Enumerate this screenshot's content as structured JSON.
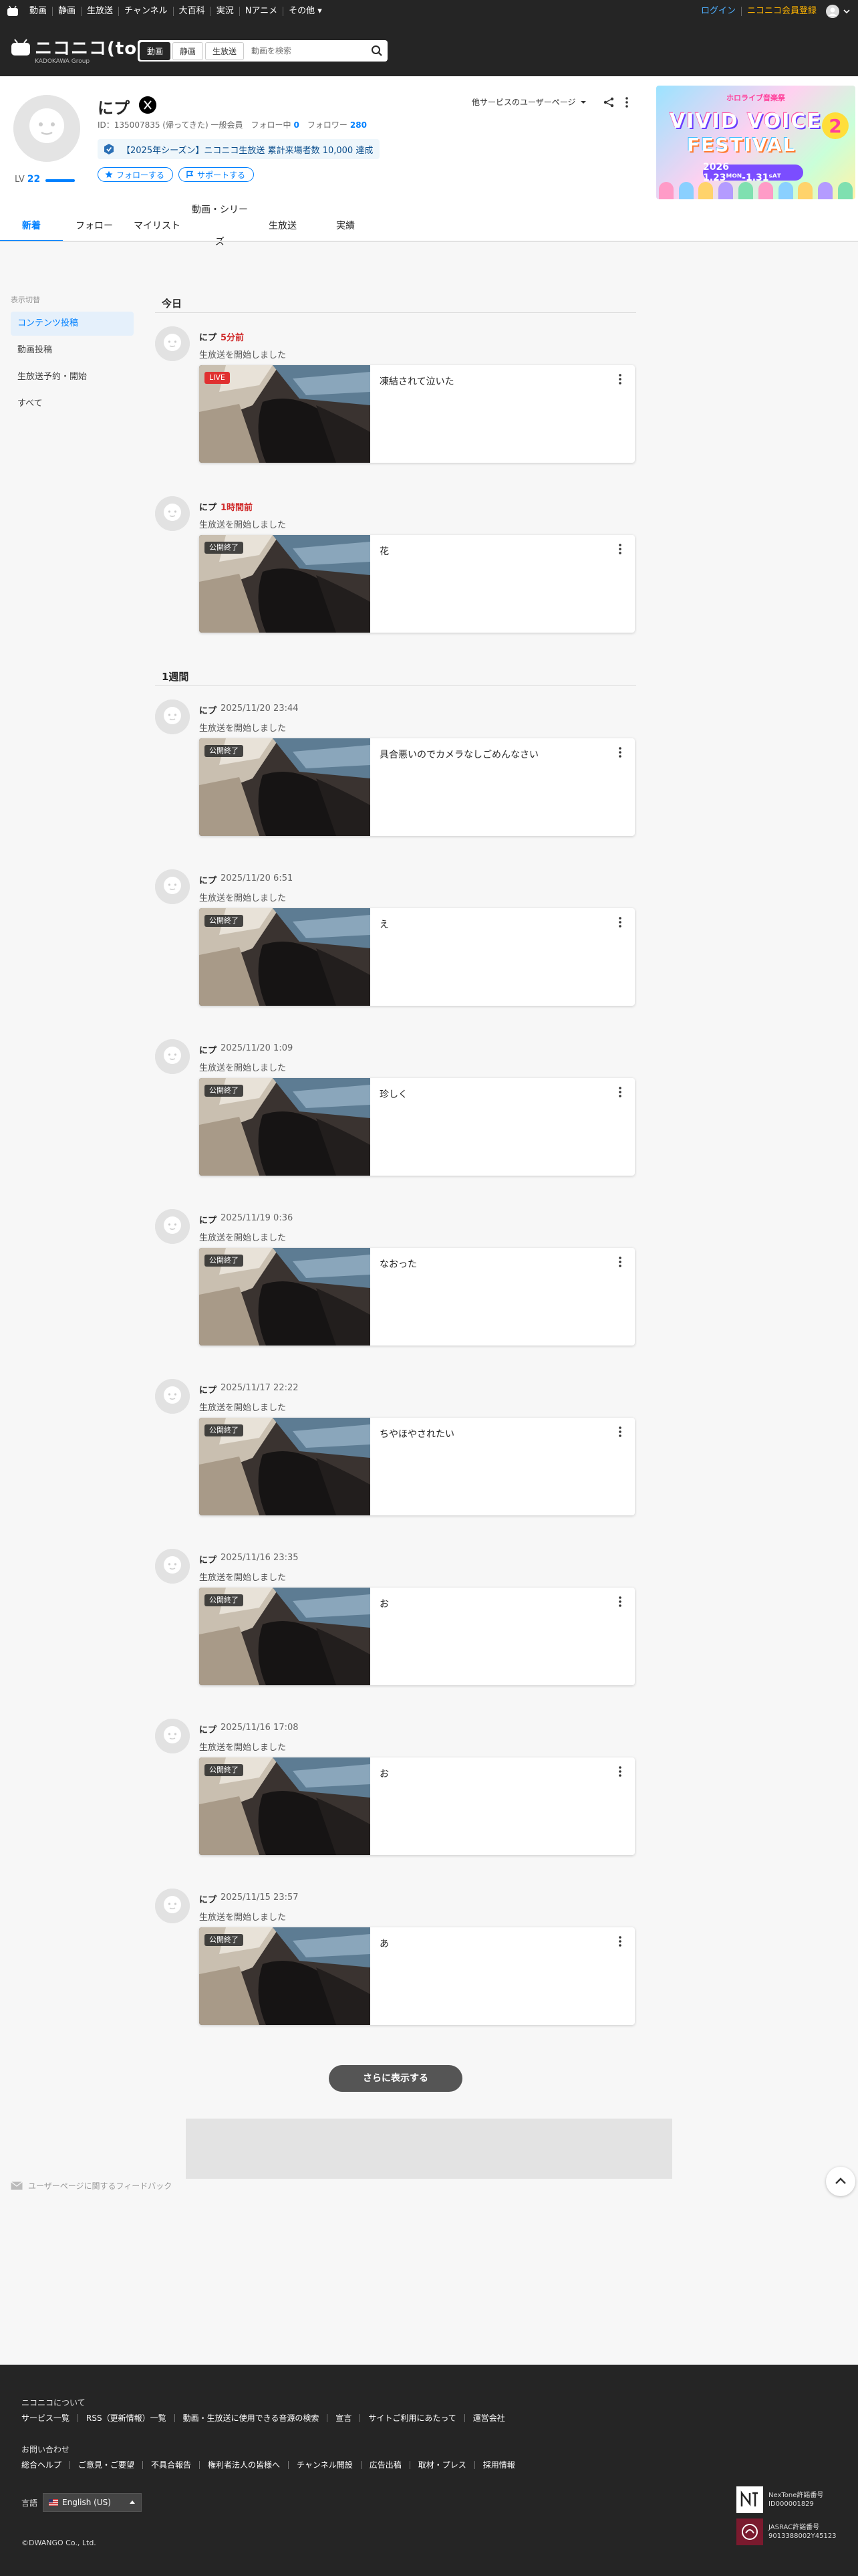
{
  "topbar": {
    "nav": [
      "動画",
      "静画",
      "生放送",
      "チャンネル",
      "大百科",
      "実況",
      "Nアニメ",
      "その他 ▾"
    ],
    "login": "ログイン",
    "register": "ニコニコ会員登録",
    "colors": {
      "login": "#4fb0ff",
      "register": "#ffb400"
    }
  },
  "header": {
    "logo_text": "ニコニコ(toi)",
    "logo_sub": "KADOKAWA Group",
    "search_tabs": [
      "動画",
      "静画",
      "生放送"
    ],
    "search_placeholder": "動画を検索"
  },
  "profile": {
    "name": "にプ",
    "meta_id": "ID：135007835 (帰ってきた) 一般会員",
    "following_label": "フォロー中",
    "following_count": "0",
    "followers_label": "フォロワー",
    "followers_count": "280",
    "level_label": "LV",
    "level_value": "22",
    "achievement": "【2025年シーズン】ニコニコ生放送 累計来場者数 10,000 達成",
    "follow_button": "フォローする",
    "support_button": "サポートする",
    "other_services": "他サービスのユーザーページ",
    "accent": "#0080ff"
  },
  "banner": {
    "top": "ホロライブ音楽祭",
    "title1": "VIVID VOICE",
    "title2": "FESTIVAL",
    "number": "2",
    "date": "2026 1.23ᴹᴼᴺ-1.31ˢᴬᵀ"
  },
  "tabs": [
    "新着",
    "フォロー",
    "マイリスト",
    "動画・シリーズ",
    "生放送",
    "実績"
  ],
  "sidebar": {
    "heading": "表示切替",
    "items": [
      "コンテンツ投稿",
      "動画投稿",
      "生放送予約・開始",
      "すべて"
    ]
  },
  "sections": {
    "today": "今日",
    "week": "1週間"
  },
  "feed": [
    {
      "user": "にプ",
      "time": "5分前",
      "action": "生放送を開始しました",
      "badge": "LIVE",
      "title": "凍結されて泣いた"
    },
    {
      "user": "にプ",
      "time": "1時間前",
      "action": "生放送を開始しました",
      "badge": "公開終了",
      "title": "花"
    },
    {
      "user": "にプ",
      "time": "2025/11/20 23:44",
      "action": "生放送を開始しました",
      "badge": "公開終了",
      "title": "具合悪いのでカメラなしごめんなさい"
    },
    {
      "user": "にプ",
      "time": "2025/11/20 6:51",
      "action": "生放送を開始しました",
      "badge": "公開終了",
      "title": "え"
    },
    {
      "user": "にプ",
      "time": "2025/11/20 1:09",
      "action": "生放送を開始しました",
      "badge": "公開終了",
      "title": "珍しく"
    },
    {
      "user": "にプ",
      "time": "2025/11/19 0:36",
      "action": "生放送を開始しました",
      "badge": "公開終了",
      "title": "なおった"
    },
    {
      "user": "にプ",
      "time": "2025/11/17 22:22",
      "action": "生放送を開始しました",
      "badge": "公開終了",
      "title": "ちやほやされたい"
    },
    {
      "user": "にプ",
      "time": "2025/11/16 23:35",
      "action": "生放送を開始しました",
      "badge": "公開終了",
      "title": "お"
    },
    {
      "user": "にプ",
      "time": "2025/11/16 17:08",
      "action": "生放送を開始しました",
      "badge": "公開終了",
      "title": "お"
    },
    {
      "user": "にプ",
      "time": "2025/11/15 23:57",
      "action": "生放送を開始しました",
      "badge": "公開終了",
      "title": "あ"
    }
  ],
  "more_button": "さらに表示する",
  "feedback": "ユーザーページに関するフィードバック",
  "footer": {
    "about_heading": "ニコニコについて",
    "about_links": [
      "サービス一覧",
      "RSS（更新情報）一覧",
      "動画・生放送に使用できる音源の検索",
      "宣言",
      "サイトご利用にあたって",
      "運営会社"
    ],
    "contact_heading": "お問い合わせ",
    "contact_links": [
      "総合ヘルプ",
      "ご意見・ご要望",
      "不具合報告",
      "権利者法人の皆様へ",
      "チャンネル開設",
      "広告出稿",
      "取材・プレス",
      "採用情報"
    ],
    "lang_label": "言語",
    "lang_value": "English (US)",
    "copyright": "©DWANGO Co., Ltd.",
    "license1_a": "NexTone許諾番号",
    "license1_b": "ID000001829",
    "license2_a": "JASRAC許諾番号",
    "license2_b": "9013388002Y45123"
  }
}
